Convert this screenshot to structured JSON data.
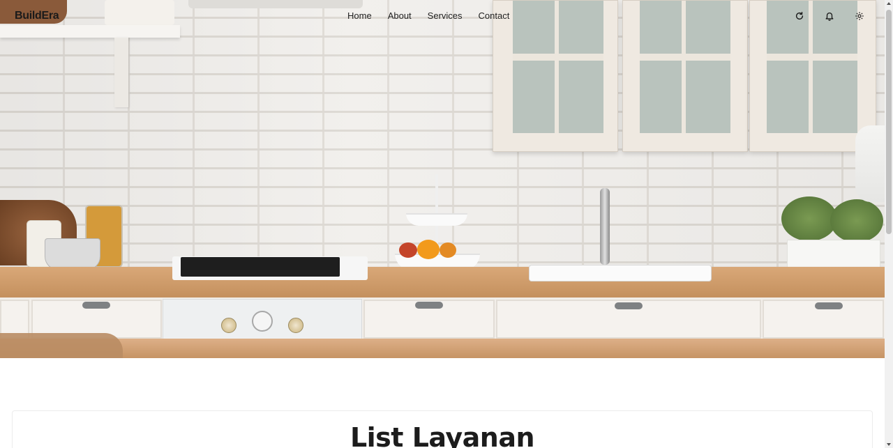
{
  "brand": {
    "name": "BuildEra"
  },
  "nav": {
    "links": [
      {
        "label": "Home"
      },
      {
        "label": "About"
      },
      {
        "label": "Services"
      },
      {
        "label": "Contact"
      }
    ],
    "icons": [
      "refresh-icon",
      "bell-icon",
      "gear-icon"
    ]
  },
  "hero": {
    "image": "kitchen-photo"
  },
  "section": {
    "title": "List Layanan"
  },
  "colors": {
    "text": "#1a1a1a",
    "background": "#ffffff",
    "counter_wood": "#d9a878",
    "wall": "#f1efec"
  }
}
